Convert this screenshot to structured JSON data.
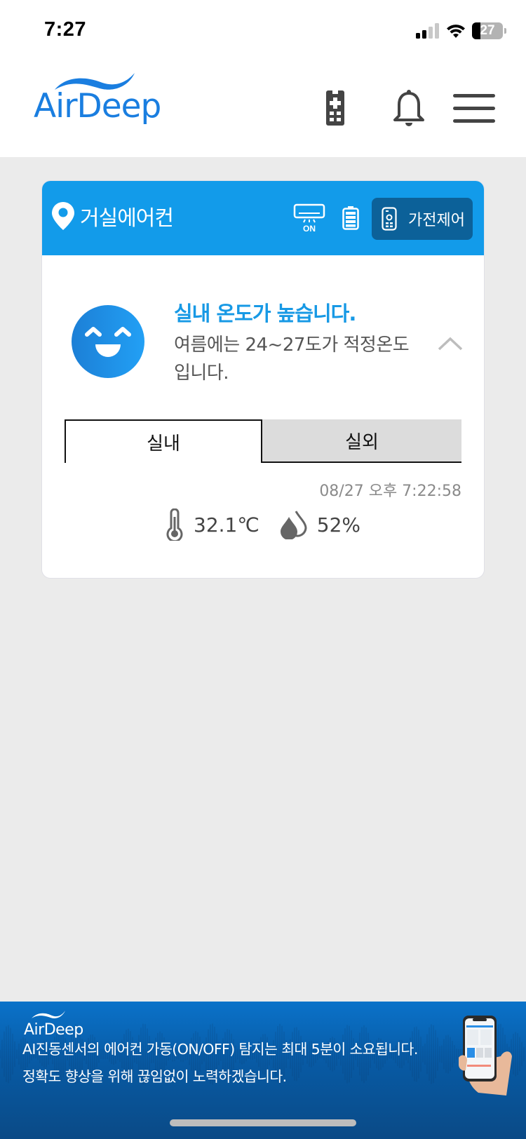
{
  "status_bar": {
    "time": "7:27",
    "battery_level": "27",
    "battery_fraction": 0.27,
    "signal_bars_active": 2,
    "signal_bars_total": 4
  },
  "header": {
    "logo_text": "AirDeep",
    "icons": [
      "remote-icon",
      "bell-icon",
      "menu-icon"
    ],
    "brand_color": "#1a7ee0",
    "icon_color": "#444444"
  },
  "device_card": {
    "device_name": "거실에어컨",
    "ac_status_label": "ON",
    "control_button_label": "가전제어",
    "header_color": "#129bea",
    "control_button_color": "#0c6199",
    "status": {
      "title": "실내 온도가 높습니다.",
      "description": "여름에는 24~27도가 적정온도입니다.",
      "title_color": "#1799e5",
      "mood_icon": "happy-face-icon"
    },
    "tabs": [
      {
        "label": "실내",
        "active": true
      },
      {
        "label": "실외",
        "active": false
      }
    ],
    "timestamp": "08/27 오후 7:22:58",
    "temperature": "32.1℃",
    "humidity": "52%"
  },
  "banner": {
    "logo_text": "AirDeep",
    "line1": "AI진동센서의 에어컨 가동(ON/OFF) 탐지는 최대 5분이 소요됩니다.",
    "line2": "정확도 향상을 위해 끊임없이 노력하겠습니다."
  }
}
